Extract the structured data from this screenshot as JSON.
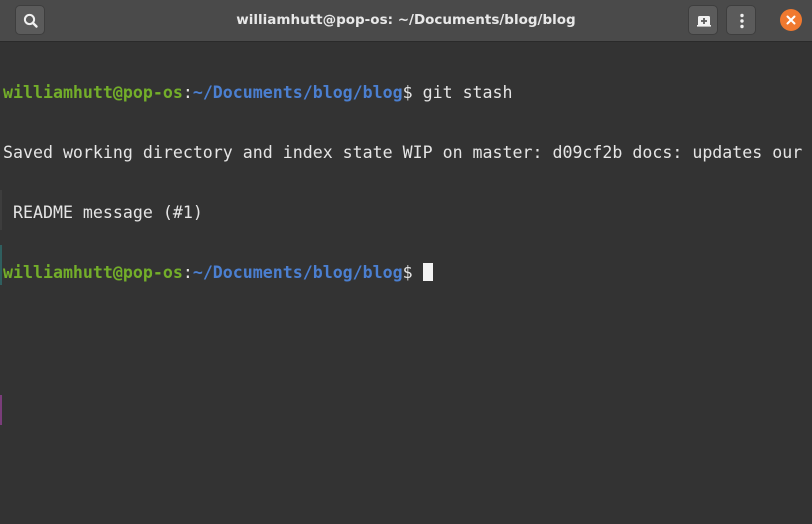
{
  "window": {
    "title": "williamhutt@pop-os: ~/Documents/blog/blog"
  },
  "titlebar": {
    "buttons": [
      {
        "icon": "search-icon"
      },
      {
        "icon": "new-tab-icon"
      },
      {
        "icon": "menu-dots-icon"
      },
      {
        "icon": "close-icon"
      }
    ],
    "close_color": "#f0792f"
  },
  "terminal": {
    "prompt1": {
      "user": "williamhutt@pop-os",
      "sep": ":",
      "path": "~/Documents/blog/blog",
      "sym": "$ ",
      "command": "git stash"
    },
    "output": [
      "Saved working directory and index state WIP on master: d09cf2b docs: updates our",
      " README message (#1)"
    ],
    "prompt2": {
      "user": "williamhutt@pop-os",
      "sep": ":",
      "path": "~/Documents/blog/blog",
      "sym": "$ "
    },
    "colors": {
      "user": "#73ae2a",
      "path": "#4b7fd0",
      "text": "#e5e5e5",
      "background": "#333333"
    }
  }
}
